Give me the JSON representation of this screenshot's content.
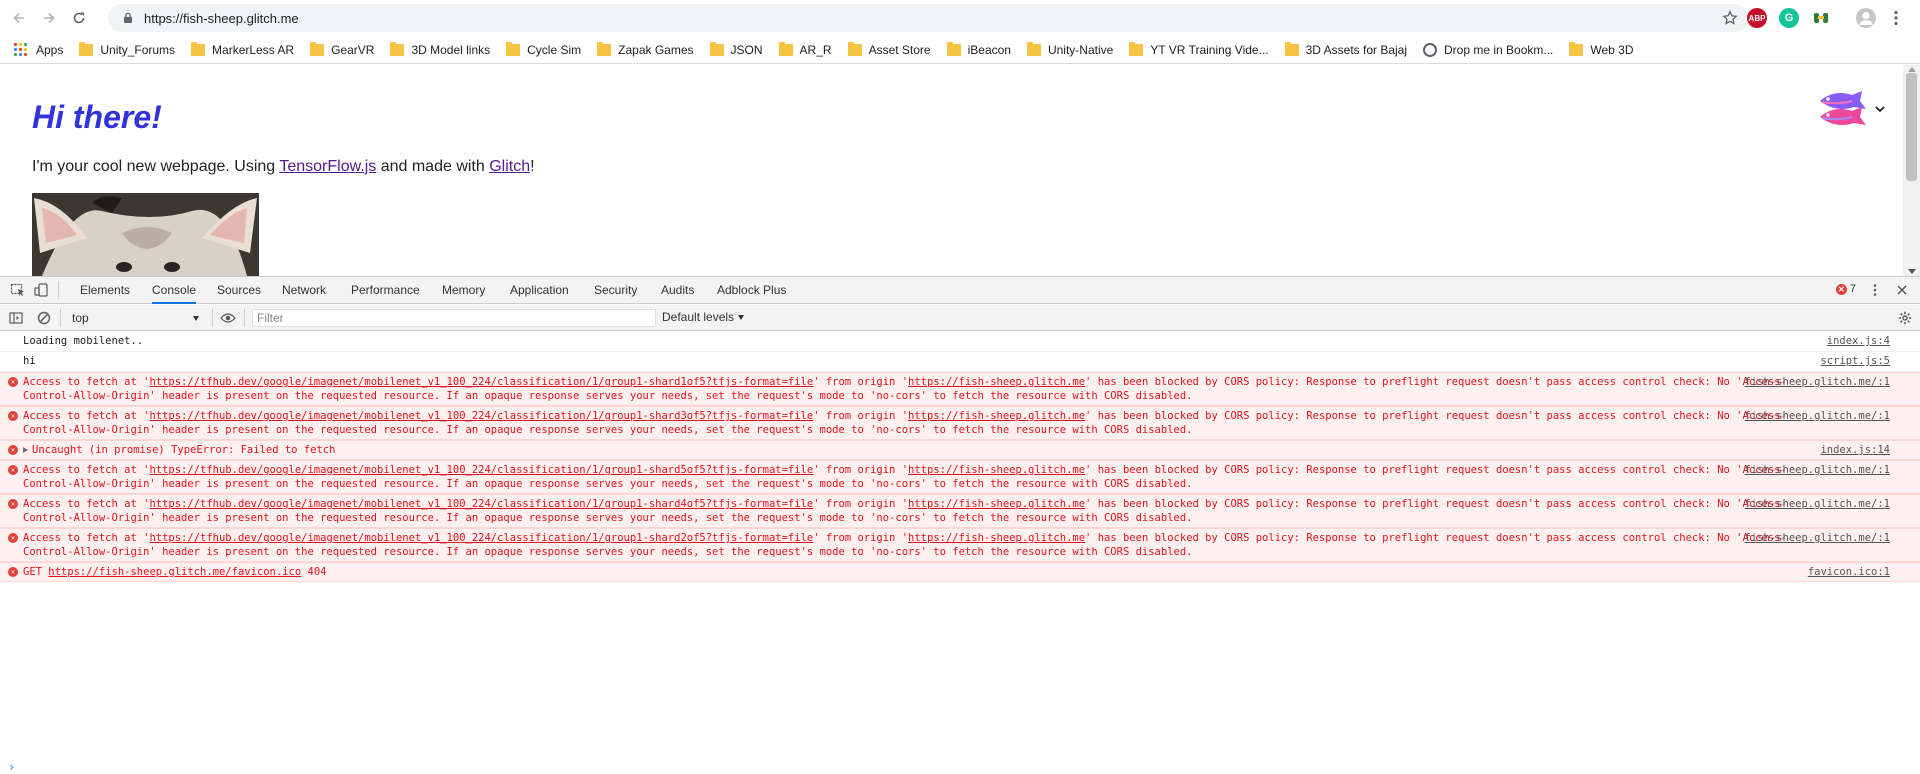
{
  "browser": {
    "url": "https://fish-sheep.glitch.me",
    "extensions": {
      "abp": "ABP",
      "grammarly": "G"
    }
  },
  "bookmarks": [
    {
      "label": "Apps",
      "kind": "apps"
    },
    {
      "label": "Unity_Forums",
      "kind": "folder"
    },
    {
      "label": "MarkerLess AR",
      "kind": "folder"
    },
    {
      "label": "GearVR",
      "kind": "folder"
    },
    {
      "label": "3D Model links",
      "kind": "folder"
    },
    {
      "label": "Cycle Sim",
      "kind": "folder"
    },
    {
      "label": "Zapak Games",
      "kind": "folder"
    },
    {
      "label": "JSON",
      "kind": "folder"
    },
    {
      "label": "AR_R",
      "kind": "folder"
    },
    {
      "label": "Asset Store",
      "kind": "folder"
    },
    {
      "label": "iBeacon",
      "kind": "folder"
    },
    {
      "label": "Unity-Native",
      "kind": "folder"
    },
    {
      "label": "YT VR Training Vide...",
      "kind": "folder"
    },
    {
      "label": "3D Assets for Bajaj",
      "kind": "folder"
    },
    {
      "label": "Drop me in Bookm...",
      "kind": "globe"
    },
    {
      "label": "Web 3D",
      "kind": "folder"
    }
  ],
  "page": {
    "title": "Hi there!",
    "intro_before": "I'm your cool new webpage. Using ",
    "link_tf": "TensorFlow.js",
    "intro_mid": " and made with ",
    "link_glitch": "Glitch",
    "intro_after": "!"
  },
  "devtools": {
    "tabs": [
      "Elements",
      "Console",
      "Sources",
      "Network",
      "Performance",
      "Memory",
      "Application",
      "Security",
      "Audits",
      "Adblock Plus"
    ],
    "active_tab": "Console",
    "error_count": "7",
    "context": "top",
    "filter_placeholder": "Filter",
    "levels": "Default levels"
  },
  "console": {
    "rows": [
      {
        "type": "info",
        "text": "Loading mobilenet..",
        "source": "index.js:4"
      },
      {
        "type": "info",
        "text": "hi",
        "source": "script.js:5"
      },
      {
        "type": "cors",
        "pre": "Access to fetch at '",
        "url": "https://tfhub.dev/google/imagenet/mobilenet_v1_100_224/classification/1/group1-shard1of5?tfjs-format=file",
        "mid": "' from origin '",
        "origin": "https://fish-sheep.glitch.me",
        "post": "' has been blocked by CORS policy: Response to preflight request doesn't pass access control check: No 'Access-Control-Allow-Origin' header is present on the requested resource. If an opaque response serves your needs, set the request's mode to 'no-cors' to fetch the resource with CORS disabled.",
        "source": "fish-sheep.glitch.me/:1"
      },
      {
        "type": "cors",
        "pre": "Access to fetch at '",
        "url": "https://tfhub.dev/google/imagenet/mobilenet_v1_100_224/classification/1/group1-shard3of5?tfjs-format=file",
        "mid": "' from origin '",
        "origin": "https://fish-sheep.glitch.me",
        "post": "' has been blocked by CORS policy: Response to preflight request doesn't pass access control check: No 'Access-Control-Allow-Origin' header is present on the requested resource. If an opaque response serves your needs, set the request's mode to 'no-cors' to fetch the resource with CORS disabled.",
        "source": "fish-sheep.glitch.me/:1"
      },
      {
        "type": "uncaught",
        "text": "Uncaught (in promise) TypeError: Failed to fetch",
        "source": "index.js:14"
      },
      {
        "type": "cors",
        "pre": "Access to fetch at '",
        "url": "https://tfhub.dev/google/imagenet/mobilenet_v1_100_224/classification/1/group1-shard5of5?tfjs-format=file",
        "mid": "' from origin '",
        "origin": "https://fish-sheep.glitch.me",
        "post": "' has been blocked by CORS policy: Response to preflight request doesn't pass access control check: No 'Access-Control-Allow-Origin' header is present on the requested resource. If an opaque response serves your needs, set the request's mode to 'no-cors' to fetch the resource with CORS disabled.",
        "source": "fish-sheep.glitch.me/:1"
      },
      {
        "type": "cors",
        "pre": "Access to fetch at '",
        "url": "https://tfhub.dev/google/imagenet/mobilenet_v1_100_224/classification/1/group1-shard4of5?tfjs-format=file",
        "mid": "' from origin '",
        "origin": "https://fish-sheep.glitch.me",
        "post": "' has been blocked by CORS policy: Response to preflight request doesn't pass access control check: No 'Access-Control-Allow-Origin' header is present on the requested resource. If an opaque response serves your needs, set the request's mode to 'no-cors' to fetch the resource with CORS disabled.",
        "source": "fish-sheep.glitch.me/:1"
      },
      {
        "type": "cors",
        "pre": "Access to fetch at '",
        "url": "https://tfhub.dev/google/imagenet/mobilenet_v1_100_224/classification/1/group1-shard2of5?tfjs-format=file",
        "mid": "' from origin '",
        "origin": "https://fish-sheep.glitch.me",
        "post": "' has been blocked by CORS policy: Response to preflight request doesn't pass access control check: No 'Access-Control-Allow-Origin' header is present on the requested resource. If an opaque response serves your needs, set the request's mode to 'no-cors' to fetch the resource with CORS disabled.",
        "source": "fish-sheep.glitch.me/:1"
      },
      {
        "type": "get",
        "pre": "GET ",
        "url": "https://fish-sheep.glitch.me/favicon.ico",
        "post": " 404",
        "source": "favicon.ico:1"
      }
    ]
  },
  "colors": {
    "heading": "#3333dd",
    "error_text": "#e0141e",
    "error_bg": "#fff0f0",
    "active_tab_underline": "#1a73e8"
  },
  "icons": {
    "back": "arrow-left-icon",
    "forward": "arrow-right-icon",
    "reload": "reload-icon",
    "lock": "lock-icon",
    "star": "star-icon",
    "inspect": "inspect-element-icon",
    "device": "device-toolbar-icon",
    "sidebar": "sidebar-toggle-icon",
    "clear": "clear-console-icon",
    "eye": "live-expression-icon",
    "settings": "gear-icon",
    "more": "kebab-menu-icon",
    "close": "close-icon",
    "error": "error-circle-icon"
  }
}
